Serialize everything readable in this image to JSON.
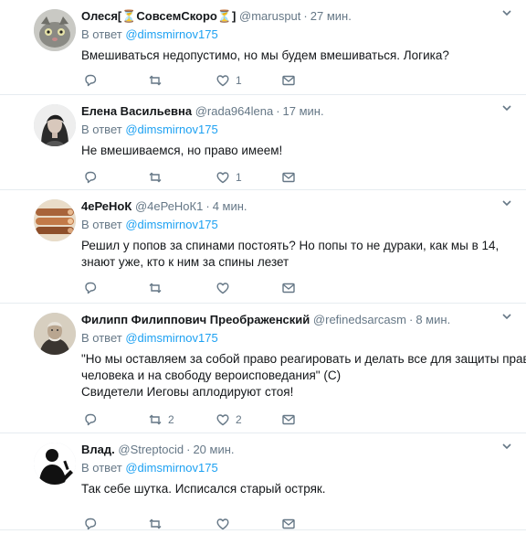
{
  "tweets": [
    {
      "name": "Олеся[⏳СовсемСкоро⏳]",
      "handle": "@marusput",
      "time": "27 мин.",
      "reply_prefix": "В ответ",
      "reply_to": "@dimsmirnov175",
      "lines": [
        "Вмешиваться недопустимо, но мы будем вмешиваться. Логика?"
      ],
      "retweets": "",
      "likes": "1"
    },
    {
      "name": "Елена Васильевна",
      "handle": "@rada964lena",
      "time": "17 мин.",
      "reply_prefix": "В ответ",
      "reply_to": "@dimsmirnov175",
      "lines": [
        "Не вмешиваемся, но право имеем!"
      ],
      "retweets": "",
      "likes": "1"
    },
    {
      "name": "4еРеНоК",
      "handle": "@4еРеНоК1",
      "time": "4 мин.",
      "reply_prefix": "В ответ",
      "reply_to": "@dimsmirnov175",
      "lines": [
        "Решил у попов за спинами постоять? Но попы то не дураки, как мы в 14,",
        "знают уже, кто к ним за спины лезет"
      ],
      "retweets": "",
      "likes": ""
    },
    {
      "name": "Филипп Филиппович Преображенский",
      "handle": "@refinedsarcasm",
      "time": "8 мин.",
      "reply_prefix": "В ответ",
      "reply_to": "@dimsmirnov175",
      "lines": [
        "\"Но мы оставляем за собой право реагировать и делать все для защиты прав",
        "человека и на свободу вероисповедания\" (С)",
        "Свидетели Иеговы аплодируют стоя!"
      ],
      "retweets": "2",
      "likes": "2"
    },
    {
      "name": "Влад.",
      "handle": "@Streptocid",
      "time": "20 мин.",
      "reply_prefix": "В ответ",
      "reply_to": "@dimsmirnov175",
      "lines": [
        "Так себе шутка. Исписался старый остряк."
      ],
      "retweets": "",
      "likes": ""
    }
  ],
  "icons": {
    "reply": "reply-icon",
    "retweet": "retweet-icon",
    "like": "heart-icon",
    "message": "envelope-icon",
    "caret": "chevron-down-icon"
  },
  "colors": {
    "link": "#1da1f2",
    "muted": "#657786",
    "border": "#e6ecf0"
  }
}
